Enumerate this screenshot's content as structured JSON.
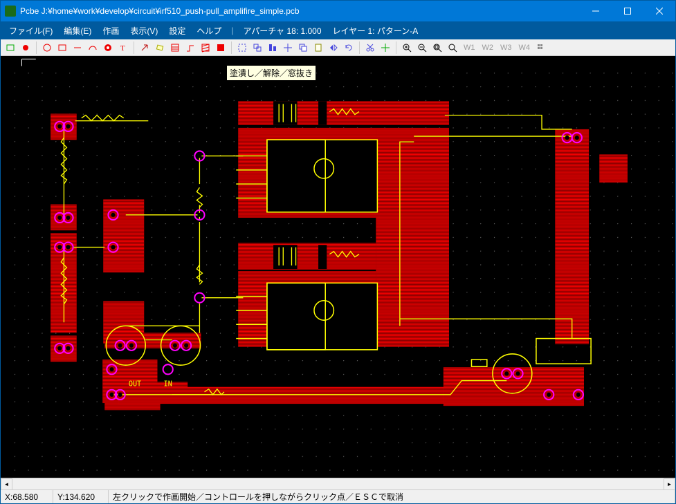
{
  "window": {
    "title": "Pcbe J:¥home¥work¥develop¥circuit¥irf510_push-pull_amplifire_simple.pcb"
  },
  "menu": {
    "file": "ファイル(F)",
    "edit": "編集(E)",
    "draw": "作画",
    "view": "表示(V)",
    "settings": "設定",
    "help": "ヘルプ",
    "aperture": "アパーチャ 18: 1.000",
    "layer": "レイヤー 1: パターン-A"
  },
  "toolbar": {
    "w1": "W1",
    "w2": "W2",
    "w3": "W3",
    "w4": "W4"
  },
  "tooltip": "塗潰し／解除／窓抜き",
  "silk": {
    "out": "OUT",
    "in": "IN"
  },
  "status": {
    "x": "X:68.580",
    "y": "Y:134.620",
    "msg": "左クリックで作画開始／コントロールを押しながらクリック点／ＥＳＣで取消"
  },
  "colors": {
    "titlebar": "#0078d7",
    "fill": "#ff0000",
    "trace": "#ffff00",
    "pad": "#ff00ff"
  }
}
